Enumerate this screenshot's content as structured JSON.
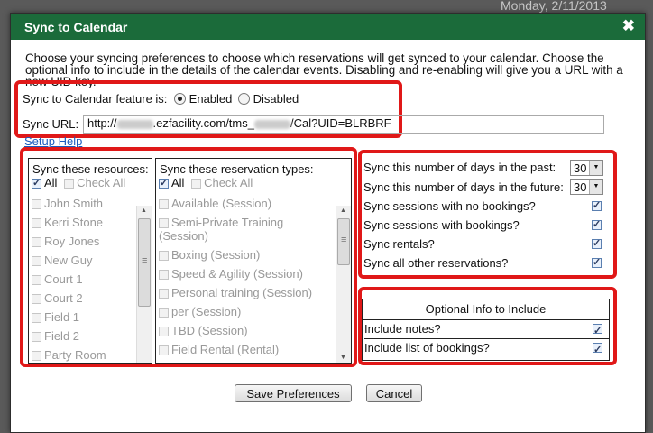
{
  "background": {
    "date_text": "Monday, 2/11/2013"
  },
  "dialog": {
    "title": "Sync to Calendar",
    "close_icon": "✖",
    "intro": "Choose your syncing preferences to choose which reservations will get synced to your calendar. Choose the optional info to include in the details of the calendar events. Disabling and re-enabling will give you a URL with a new UID key."
  },
  "feature": {
    "label": "Sync to Calendar feature is:",
    "enabled_label": "Enabled",
    "disabled_label": "Disabled",
    "selected": "Enabled"
  },
  "sync_url": {
    "label": "Sync URL:",
    "prefix": "http://",
    "middle": ".ezfacility.com/tms_",
    "suffix": "/Cal?UID=BLRBRF",
    "setup_help": "Setup Help"
  },
  "resources": {
    "header": "Sync these resources:",
    "all_label": "All",
    "check_all_label": "Check All",
    "items": [
      "John Smith",
      "Kerri Stone",
      "Roy Jones",
      "New Guy",
      "Court 1",
      "Court 2",
      "Field 1",
      "Field 2",
      "Party Room"
    ]
  },
  "reservation_types": {
    "header": "Sync these reservation types:",
    "all_label": "All",
    "check_all_label": "Check All",
    "items": [
      "Available (Session)",
      "Semi-Private Training (Session)",
      "Boxing (Session)",
      "Speed & Agility (Session)",
      "Personal training (Session)",
      "per (Session)",
      "TBD (Session)",
      "Field Rental (Rental)"
    ]
  },
  "sync_options": {
    "days_past_label": "Sync this number of days in the past:",
    "days_past_value": "30",
    "days_future_label": "Sync this number of days in the future:",
    "days_future_value": "30",
    "no_bookings_label": "Sync sessions with no bookings?",
    "with_bookings_label": "Sync sessions with bookings?",
    "rentals_label": "Sync rentals?",
    "other_label": "Sync all other reservations?"
  },
  "optional_info": {
    "header": "Optional Info to Include",
    "notes_label": "Include notes?",
    "bookings_list_label": "Include list of bookings?"
  },
  "buttons": {
    "save": "Save Preferences",
    "cancel": "Cancel"
  },
  "colors": {
    "titlebar": "#1b6b3a",
    "highlight": "#e01818",
    "link": "#1a5bbf"
  }
}
